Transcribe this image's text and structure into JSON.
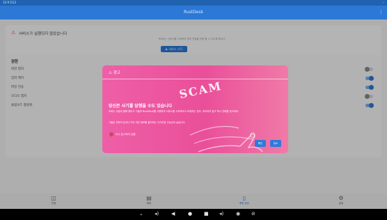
{
  "statusbar": {
    "time": "12:9 5/12",
    "system": "··"
  },
  "appbar": {
    "title": "RustDesk",
    "menu_icon": "⋮"
  },
  "service": {
    "warning_icon": "⚠",
    "message": "서비스가 실행되지 않았습니다",
    "description": "RDM는 서비스를 시작하여 원격 연결을 허용 할 수 있도록 합니다.",
    "start_label": "▶ 서비스 시작"
  },
  "permissions": {
    "heading": "권한",
    "rows": [
      {
        "label": "화면 캡처",
        "on": false
      },
      {
        "label": "입력 제어",
        "on": true
      },
      {
        "label": "파일 전송",
        "on": true
      },
      {
        "label": "오디오 캡처",
        "on": false
      },
      {
        "label": "클립보드 활성화",
        "on": true
      }
    ]
  },
  "dialog": {
    "title_icon": "⚠",
    "title": "경고",
    "scam_text": "SCAM",
    "heading": "당신은 사기를 당했을 수도 있습니다",
    "paragraph1": "모르는 사람과 통화 중이고 그들이 RustDesk를 사용하여 서비스를 시작하라고 요청하는 경우, 계속하지 말고 즉시 전화를 끊으세요.",
    "paragraph2": "그들은 귀하의 돈이나 기타 개인 정보를 훔치려는 사기꾼일 가능성이 높습니다.",
    "checkbox_label": "다시 표시하지 않음",
    "confirm_label": "확인",
    "cancel_label": "취소"
  },
  "bottomnav": [
    {
      "icon": "◫",
      "label": "연결"
    },
    {
      "icon": "▤",
      "label": "채팅"
    },
    {
      "icon": "▯",
      "label": "화면 공유"
    },
    {
      "icon": "⚙",
      "label": "설정"
    }
  ],
  "sysbar": {
    "icons": [
      "⌄",
      "◂)",
      "◀",
      "●",
      "■",
      "◂)",
      "◉",
      "⊘"
    ]
  }
}
